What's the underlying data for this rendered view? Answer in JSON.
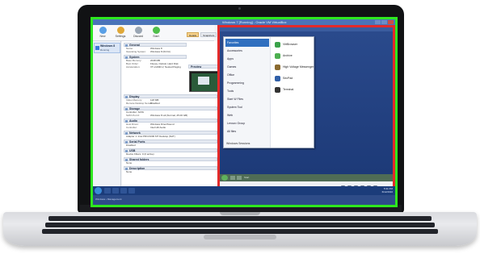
{
  "colors": {
    "screen_outline": "#2ee81e",
    "guest_outline": "#e32a2a",
    "selection": "#2f6fbf",
    "guest_desktop": "#24417e"
  },
  "window": {
    "title": "Windows 7 [Running] - Oracle VM VirtualBox"
  },
  "toolbar": {
    "new_label": "New",
    "settings_label": "Settings",
    "discard_label": "Discard",
    "start_label": "Start"
  },
  "tabs": {
    "details": "Details",
    "snapshots": "Snapshots"
  },
  "vm_list": {
    "name": "Windows 8",
    "state": "Running"
  },
  "details": {
    "general": {
      "title": "General",
      "name_key": "Name:",
      "name_val": "Windows 8",
      "os_key": "Operating System:",
      "os_val": "Windows 8 (64 bit)"
    },
    "system": {
      "title": "System",
      "mem_key": "Base Memory:",
      "mem_val": "2048 MB",
      "boot_key": "Boot Order:",
      "boot_val": "Floppy, Optical, Hard Disk",
      "accel_key": "Acceleration:",
      "accel_val": "VT-x/AMD-V, Nested Paging"
    },
    "preview_title": "Preview",
    "display": {
      "title": "Display",
      "video_key": "Video Memory:",
      "video_val": "128 MB",
      "rdp_key": "Remote Desktop Server:",
      "rdp_val": "Disabled"
    },
    "storage": {
      "title": "Storage",
      "ctrl_key": "Controller: SATA",
      "port_key": "SATA Port 0:",
      "port_val": "Windows 8.vdi (Normal, 25.00 GB)"
    },
    "audio": {
      "title": "Audio",
      "drv_key": "Host Driver:",
      "drv_val": "Windows DirectSound",
      "ctl_key": "Controller:",
      "ctl_val": "Intel HD Audio"
    },
    "network": {
      "title": "Network",
      "adapter": "Adapter 1: Intel PRO/1000 MT Desktop (NAT)"
    },
    "serial": {
      "title": "Serial Ports",
      "val": "Disabled"
    },
    "usb": {
      "title": "USB",
      "filters": "Device Filters: 0 (0 active)"
    },
    "shared": {
      "title": "Shared folders",
      "val": "None"
    },
    "desc": {
      "title": "Description",
      "val": "None"
    }
  },
  "start_menu": {
    "left_items": [
      "Favorites",
      "Accessories",
      "Apps",
      "Games",
      "Office",
      "Programming",
      "Tools",
      "Start W Files",
      "System Tool",
      "Web",
      "Lenovo Group",
      "All files"
    ],
    "bottom_label": "Windows Sessions",
    "right_items": [
      {
        "label": "VirtBrowser",
        "color": "#3aa24a"
      },
      {
        "label": "Archive",
        "color": "#4caf50"
      },
      {
        "label": "High Voltage Messenger",
        "color": "#8a6a2f"
      },
      {
        "label": "SecPad",
        "color": "#2f5fa8"
      },
      {
        "label": "Terminal",
        "color": "#333333"
      }
    ]
  },
  "guest_taskbar": {
    "label": "Start"
  },
  "host_clock": {
    "time": "5:31 PM",
    "date": "6/12/2016"
  },
  "host_status": {
    "text": "Windows • Management"
  }
}
